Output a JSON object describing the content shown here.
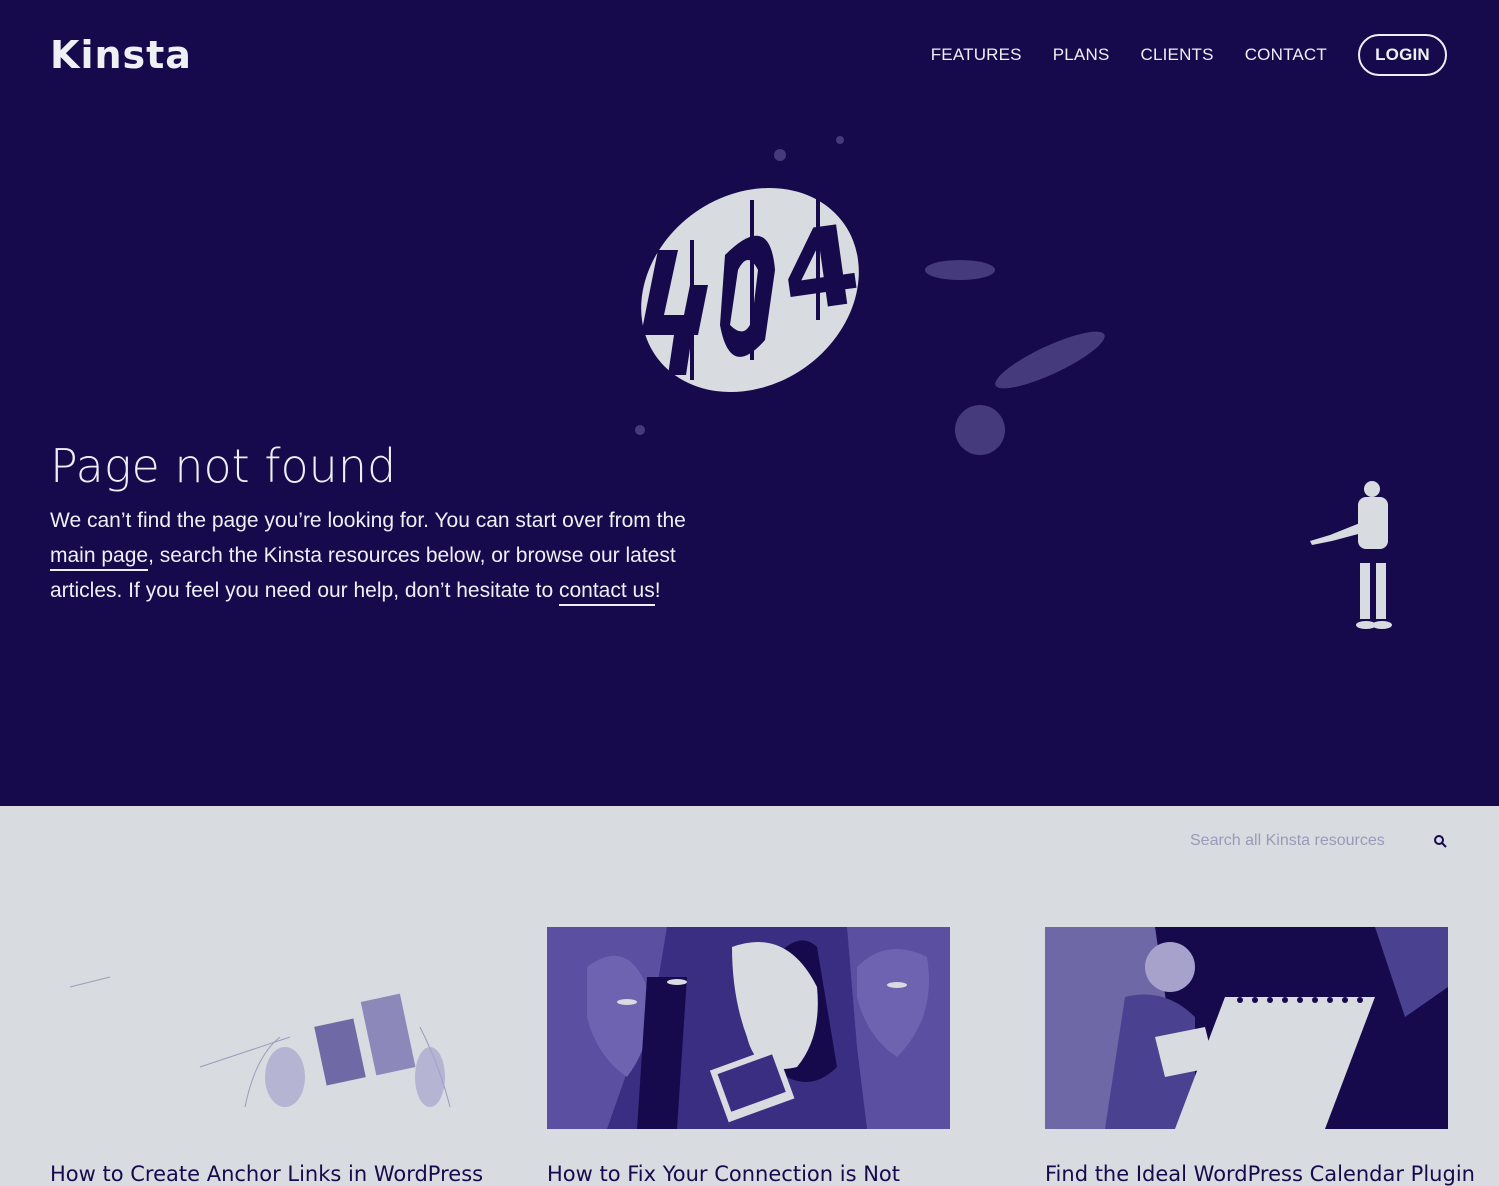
{
  "header": {
    "logo": "Kinsta",
    "nav": [
      "FEATURES",
      "PLANS",
      "CLIENTS",
      "CONTACT"
    ],
    "login": "LOGIN"
  },
  "hero": {
    "error_code": "404",
    "title": "Page not found",
    "desc_part1": "We can’t find the page you’re looking for. You can start over from the ",
    "main_link": "main page",
    "desc_part2": ", search the Kinsta resources below, or browse our latest articles. If you feel you need our help, don’t hesitate to ",
    "contact_link": "contact us",
    "desc_part3": "!"
  },
  "search": {
    "placeholder": "Search all Kinsta resources"
  },
  "articles": [
    {
      "title": "How to Create Anchor Links in WordPress"
    },
    {
      "title": "How to Fix Your Connection is Not"
    },
    {
      "title": "Find the Ideal WordPress Calendar Plugin"
    }
  ],
  "colors": {
    "navy": "#160a4d",
    "light": "#d8dbe0",
    "white": "#eef0f4"
  }
}
